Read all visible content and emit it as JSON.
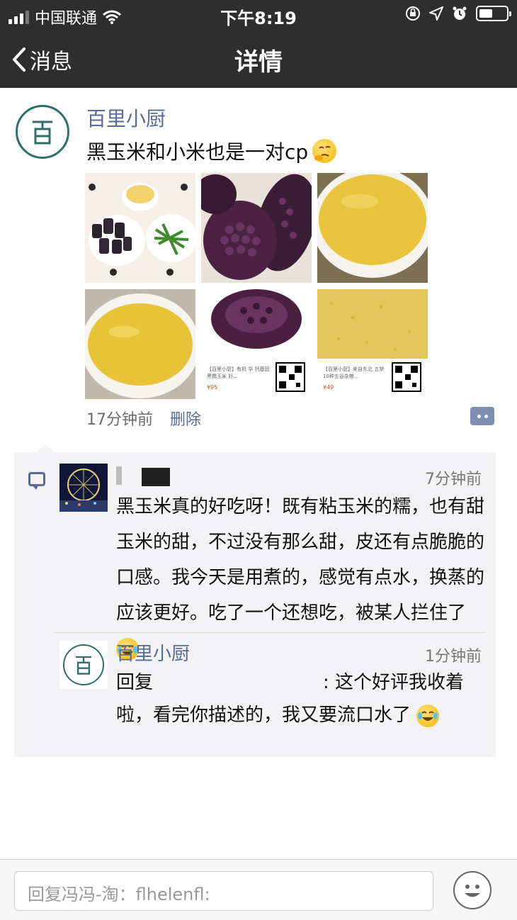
{
  "status_bar": {
    "carrier": "中国联通",
    "time": "下午8:19",
    "battery_level": 0.5
  },
  "nav": {
    "back_label": "消息",
    "title": "详情"
  },
  "post": {
    "author": "百里小厨",
    "text": "黑玉米和小米也是一对cp",
    "images": [
      {
        "kind": "meal-plate"
      },
      {
        "kind": "purple-corn"
      },
      {
        "kind": "millet-porridge"
      },
      {
        "kind": "millet-porridge"
      },
      {
        "kind": "product-card",
        "label": "【百里小厨】有机 华 钙基因 黑糯玉米 好...",
        "price": "¥95"
      },
      {
        "kind": "product-card",
        "label": "【百里小厨】来自东北 五常 10种五谷杂粮...",
        "price": "¥49"
      }
    ],
    "time_ago": "17分钟前",
    "delete_label": "删除"
  },
  "comments": [
    {
      "author": "",
      "time_ago": "7分钟前",
      "text": "黑玉米真的好吃呀！既有粘玉米的糯，也有甜玉米的甜，不过没有那么甜，皮还有点脆脆的口感。我今天是用煮的，感觉有点水，换蒸的应该更好。吃了一个还想吃，被某人拦住了"
    },
    {
      "author": "百里小厨",
      "time_ago": "1分钟前",
      "reply_prefix": "回复",
      "text": ": 这个好评我收着啦，看完你描述的，我又要流口水了"
    }
  ],
  "reply_input": {
    "placeholder": "回复冯冯-淘：flhelenfl:"
  }
}
